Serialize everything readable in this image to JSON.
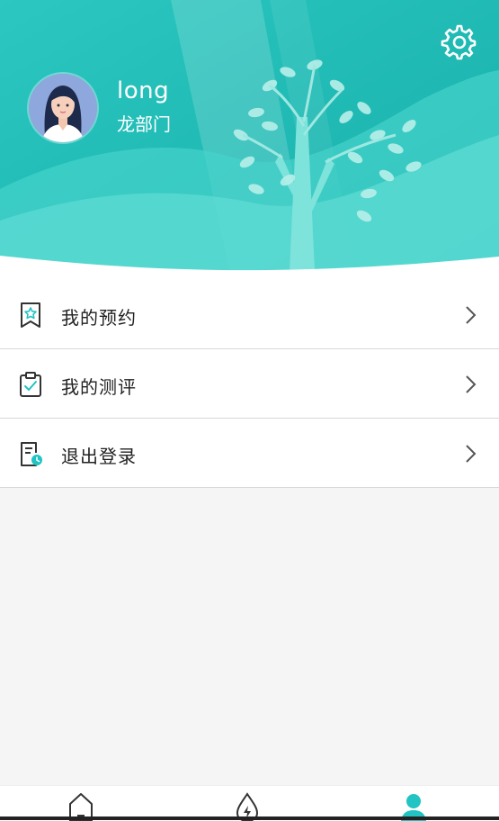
{
  "profile": {
    "name": "long",
    "department": "龙部门"
  },
  "menu": [
    {
      "label": "我的预约",
      "icon": "bookmark-star-icon"
    },
    {
      "label": "我的测评",
      "icon": "clipboard-check-icon"
    },
    {
      "label": "退出登录",
      "icon": "document-clock-icon"
    }
  ],
  "tabbar": [
    {
      "icon": "home-icon",
      "active": false
    },
    {
      "icon": "lightning-drop-icon",
      "active": false
    },
    {
      "icon": "person-icon",
      "active": true
    }
  ],
  "colors": {
    "accent": "#22c3c3",
    "header_dark": "#16b0ac",
    "header_light": "#3fd3cc",
    "icon_dark": "#333333"
  }
}
